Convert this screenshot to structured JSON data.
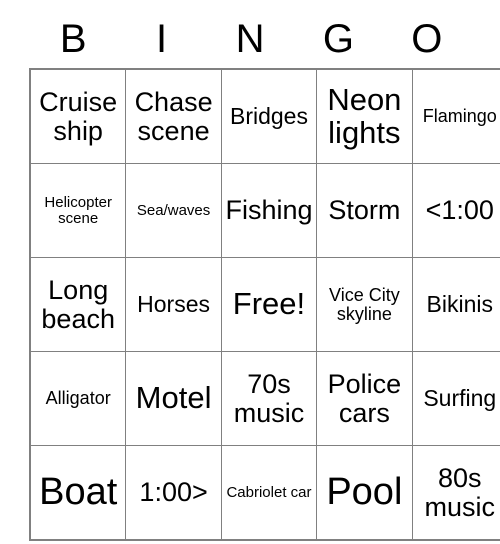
{
  "card": {
    "headers": [
      "B",
      "I",
      "N",
      "G",
      "O"
    ],
    "colors": {
      "border": "#808080",
      "cell_background": "#ffffff",
      "text": "#000000"
    },
    "rows": [
      [
        {
          "label": "Cruise ship",
          "size": "l"
        },
        {
          "label": "Chase scene",
          "size": "l"
        },
        {
          "label": "Bridges",
          "size": "m"
        },
        {
          "label": "Neon lights",
          "size": "xl"
        },
        {
          "label": "Flamingo",
          "size": "s"
        }
      ],
      [
        {
          "label": "Helicopter scene",
          "size": "xs"
        },
        {
          "label": "Sea/waves",
          "size": "xs"
        },
        {
          "label": "Fishing",
          "size": "l"
        },
        {
          "label": "Storm",
          "size": "l"
        },
        {
          "label": "<1:00",
          "size": "l"
        }
      ],
      [
        {
          "label": "Long beach",
          "size": "l"
        },
        {
          "label": "Horses",
          "size": "m"
        },
        {
          "label": "Free!",
          "size": "xl"
        },
        {
          "label": "Vice City skyline",
          "size": "s"
        },
        {
          "label": "Bikinis",
          "size": "m"
        }
      ],
      [
        {
          "label": "Alligator",
          "size": "s"
        },
        {
          "label": "Motel",
          "size": "xl"
        },
        {
          "label": "70s music",
          "size": "l"
        },
        {
          "label": "Police cars",
          "size": "l"
        },
        {
          "label": "Surfing",
          "size": "m"
        }
      ],
      [
        {
          "label": "Boat",
          "size": "xxl"
        },
        {
          "label": "1:00>",
          "size": "l"
        },
        {
          "label": "Cabriolet car",
          "size": "xs"
        },
        {
          "label": "Pool",
          "size": "xxl"
        },
        {
          "label": "80s music",
          "size": "l"
        }
      ]
    ]
  }
}
